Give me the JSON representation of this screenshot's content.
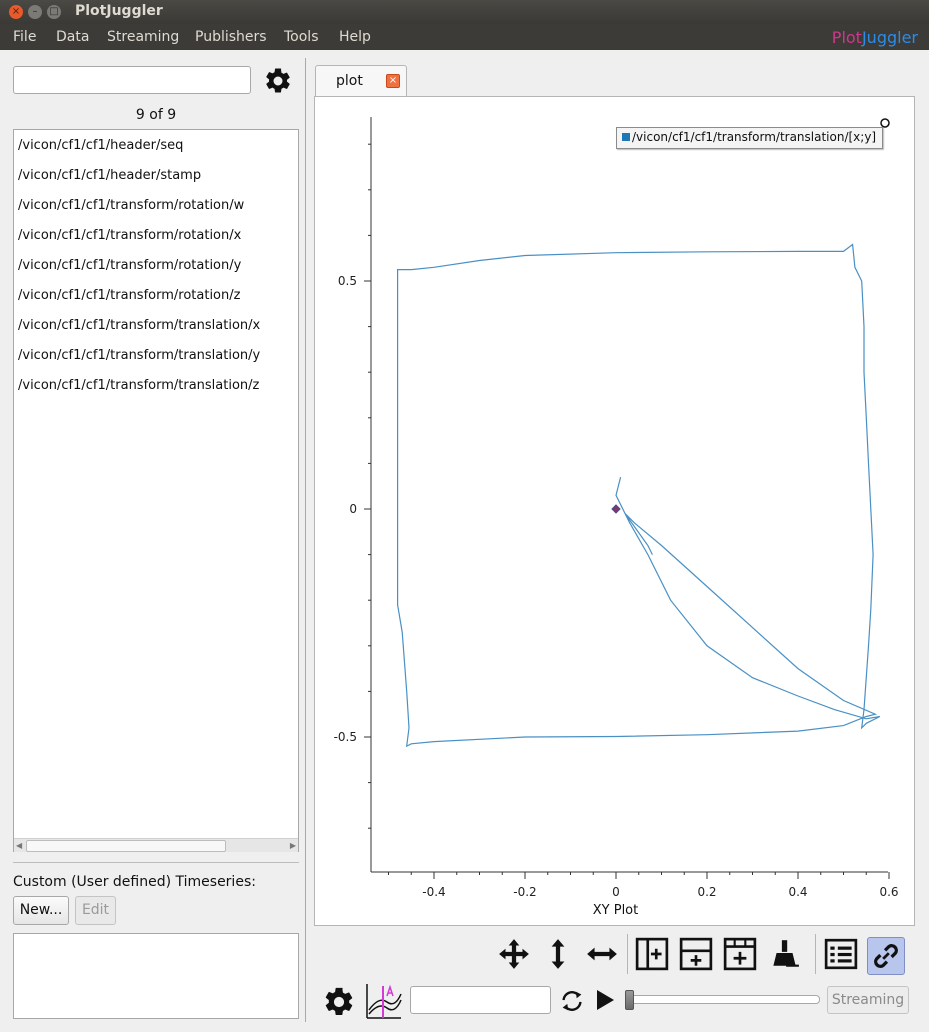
{
  "window": {
    "title": "PlotJuggler"
  },
  "menu": [
    "File",
    "Data",
    "Streaming",
    "Publishers",
    "Tools",
    "Help"
  ],
  "logo": {
    "part1": "Plot",
    "part2": "Juggler",
    "color1": "#d0368a",
    "color2": "#2d8ce6"
  },
  "sidebar": {
    "search_value": "",
    "count_text": "9 of 9",
    "items": [
      "/vicon/cf1/cf1/header/seq",
      "/vicon/cf1/cf1/header/stamp",
      "/vicon/cf1/cf1/transform/rotation/w",
      "/vicon/cf1/cf1/transform/rotation/x",
      "/vicon/cf1/cf1/transform/rotation/y",
      "/vicon/cf1/cf1/transform/rotation/z",
      "/vicon/cf1/cf1/transform/translation/x",
      "/vicon/cf1/cf1/transform/translation/y",
      "/vicon/cf1/cf1/transform/translation/z"
    ],
    "custom_label": "Custom (User defined) Timeseries:",
    "new_button": "New...",
    "edit_button": "Edit"
  },
  "tabs": [
    {
      "label": "plot",
      "active": true
    }
  ],
  "plot": {
    "legend": "/vicon/cf1/cf1/transform/translation/[x;y]",
    "xy_label": "XY Plot"
  },
  "bottom": {
    "time_input": "",
    "streaming_button": "Streaming"
  },
  "chart_data": {
    "type": "scatter",
    "title": "",
    "xlabel": "XY Plot",
    "ylabel": "",
    "xlim": [
      -0.52,
      0.6
    ],
    "ylim": [
      -0.8,
      0.86
    ],
    "xticks": [
      -0.4,
      -0.2,
      0,
      0.2,
      0.4,
      0.6
    ],
    "yticks": [
      -0.5,
      0,
      0.5
    ],
    "legend": "top-right",
    "grid": false,
    "series": [
      {
        "name": "/vicon/cf1/cf1/transform/translation/[x;y]",
        "color": "#4a90c4",
        "points": [
          [
            0.01,
            0.07
          ],
          [
            0.0,
            0.03
          ],
          [
            0.03,
            -0.03
          ],
          [
            0.07,
            -0.1
          ],
          [
            0.12,
            -0.2
          ],
          [
            0.2,
            -0.3
          ],
          [
            0.3,
            -0.37
          ],
          [
            0.4,
            -0.41
          ],
          [
            0.48,
            -0.44
          ],
          [
            0.55,
            -0.46
          ],
          [
            0.58,
            -0.455
          ],
          [
            0.55,
            -0.47
          ],
          [
            0.54,
            -0.48
          ],
          [
            0.545,
            -0.44
          ],
          [
            0.555,
            -0.3
          ],
          [
            0.56,
            -0.22
          ],
          [
            0.565,
            -0.1
          ],
          [
            0.56,
            0.0
          ],
          [
            0.555,
            0.1
          ],
          [
            0.55,
            0.2
          ],
          [
            0.545,
            0.3
          ],
          [
            0.545,
            0.4
          ],
          [
            0.54,
            0.5
          ],
          [
            0.525,
            0.53
          ],
          [
            0.52,
            0.58
          ],
          [
            0.5,
            0.565
          ],
          [
            0.4,
            0.565
          ],
          [
            0.2,
            0.564
          ],
          [
            0.0,
            0.562
          ],
          [
            -0.2,
            0.556
          ],
          [
            -0.3,
            0.545
          ],
          [
            -0.4,
            0.53
          ],
          [
            -0.45,
            0.525
          ],
          [
            -0.48,
            0.525
          ],
          [
            -0.48,
            0.4
          ],
          [
            -0.48,
            0.2
          ],
          [
            -0.48,
            0.0
          ],
          [
            -0.48,
            -0.21
          ],
          [
            -0.47,
            -0.27
          ],
          [
            -0.46,
            -0.4
          ],
          [
            -0.455,
            -0.48
          ],
          [
            -0.46,
            -0.52
          ],
          [
            -0.45,
            -0.515
          ],
          [
            -0.4,
            -0.51
          ],
          [
            -0.2,
            -0.5
          ],
          [
            0.0,
            -0.499
          ],
          [
            0.2,
            -0.495
          ],
          [
            0.4,
            -0.487
          ],
          [
            0.5,
            -0.475
          ],
          [
            0.55,
            -0.455
          ],
          [
            0.57,
            -0.45
          ],
          [
            0.5,
            -0.42
          ],
          [
            0.4,
            -0.35
          ],
          [
            0.3,
            -0.26
          ],
          [
            0.2,
            -0.17
          ],
          [
            0.1,
            -0.08
          ],
          [
            0.04,
            -0.03
          ],
          [
            0.02,
            -0.01
          ],
          [
            0.07,
            -0.08
          ],
          [
            0.08,
            -0.1
          ]
        ]
      }
    ],
    "marker": {
      "x": 0.0,
      "y": 0.0,
      "color": "#7b3a6a"
    }
  }
}
